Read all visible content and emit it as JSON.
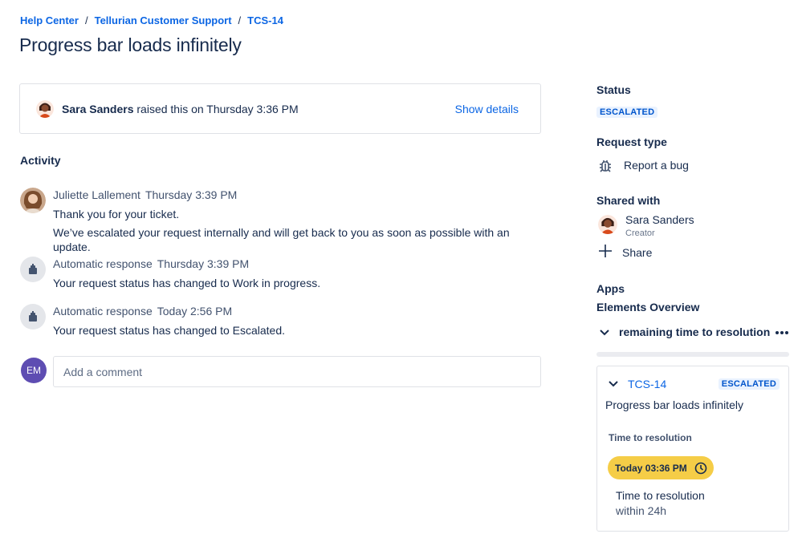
{
  "breadcrumb": {
    "items": [
      "Help Center",
      "Tellurian Customer Support",
      "TCS-14"
    ],
    "separator": "/"
  },
  "ticket": {
    "title": "Progress bar loads infinitely"
  },
  "raised": {
    "name": "Sara Sanders",
    "text": " raised this on Thursday 3:36 PM",
    "show_details": "Show details"
  },
  "activity": {
    "heading": "Activity",
    "items": [
      {
        "author": "Juliette Lallement",
        "time": "Thursday 3:39 PM",
        "lines": [
          "Thank you for your ticket.",
          "We’ve escalated your request internally and will get back to you as soon as possible with an update."
        ]
      },
      {
        "author": "Automatic response",
        "time": "Thursday 3:39 PM",
        "lines": [
          "Your request status has changed to Work in progress."
        ]
      },
      {
        "author": "Automatic response",
        "time": "Today 2:56 PM",
        "lines": [
          "Your request status has changed to Escalated."
        ]
      }
    ]
  },
  "comment": {
    "avatar_initials": "EM",
    "placeholder": "Add a comment"
  },
  "sidebar": {
    "status_label": "Status",
    "status_value": "ESCALATED",
    "request_type_label": "Request type",
    "request_type_value": "Report a bug",
    "request_type_icon": "bug-icon",
    "shared_with_label": "Shared with",
    "shared_person_name": "Sara Sanders",
    "shared_person_role": "Creator",
    "share_label": "Share",
    "apps_label": "Apps",
    "elements_label": "Elements Overview",
    "remaining_label": "remaining time to resolution"
  },
  "card": {
    "key": "TCS-14",
    "status": "ESCALATED",
    "title": "Progress bar loads infinitely",
    "ttr_label": "Time to resolution",
    "ttr_due": "Today 03:36 PM",
    "ttr_goal_title": "Time to resolution",
    "ttr_goal_sub": "within 24h"
  },
  "colors": {
    "link": "#0c66e4",
    "lozenge_bg": "#e9f2ff",
    "lozenge_text": "#0055cc",
    "sla_pill": "#f5cd47",
    "comment_avatar": "#5e4db2"
  }
}
